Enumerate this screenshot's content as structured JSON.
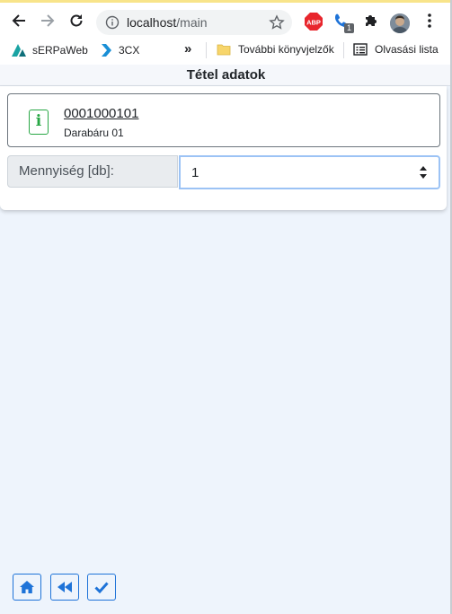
{
  "browser": {
    "url_host": "localhost",
    "url_path": "/main",
    "abp_label": "ABP",
    "phone_badge": "1",
    "bookmarks": {
      "serpaweb": "sERPaWeb",
      "threecx": "3CX",
      "overflow": "»",
      "more_bookmarks": "További könyvjelzők",
      "reading_list": "Olvasási lista"
    }
  },
  "app": {
    "title": "Tétel adatok",
    "info_badge": "i",
    "item": {
      "code": "0001000101",
      "name": "Darabáru 01"
    },
    "quantity": {
      "label": "Mennyiség [db]:",
      "value": "1"
    }
  },
  "colors": {
    "accent": "#1e73d8",
    "info_green": "#28a745",
    "background": "#eef4fc"
  }
}
